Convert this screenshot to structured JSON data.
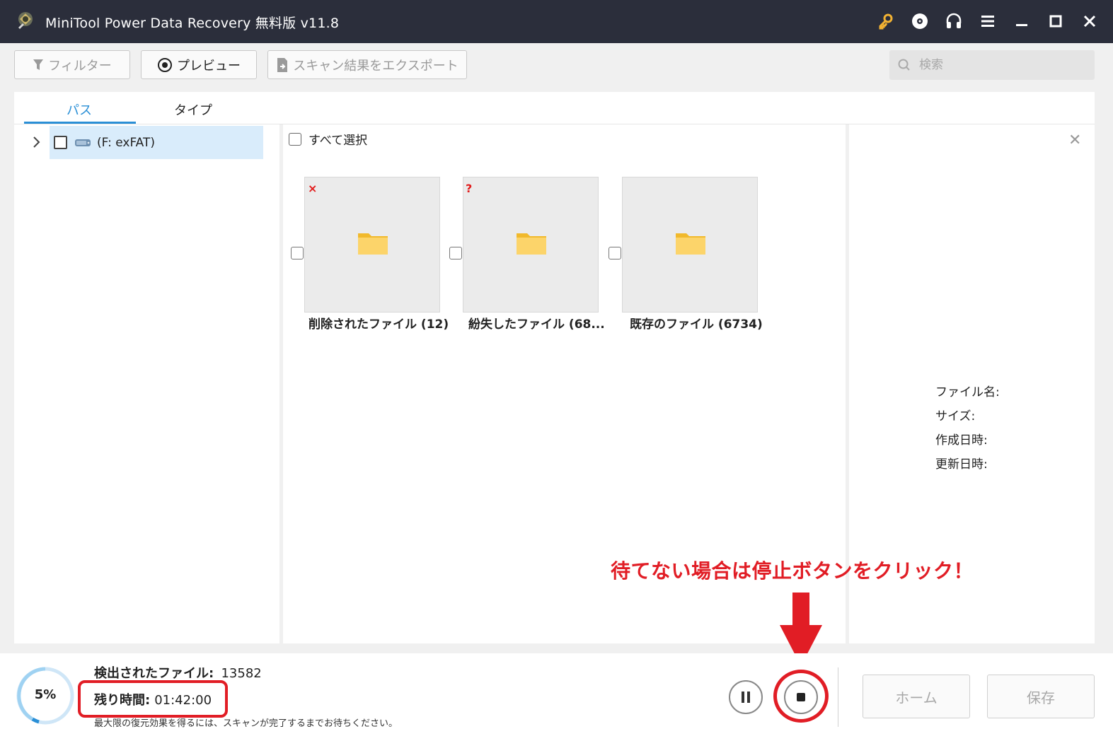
{
  "window": {
    "title": "MiniTool Power Data Recovery 無料版 v11.8",
    "icons": [
      "key-icon",
      "disc-icon",
      "headset-icon",
      "menu-icon",
      "minimize-icon",
      "maximize-icon",
      "close-icon"
    ]
  },
  "toolbar": {
    "filter_label": "フィルター",
    "preview_label": "プレビュー",
    "export_label": "スキャン結果をエクスポート",
    "search_placeholder": "検索"
  },
  "tabs": [
    {
      "label": "パス",
      "active": true
    },
    {
      "label": "タイプ",
      "active": false
    }
  ],
  "tree": {
    "items": [
      {
        "label": "(F: exFAT)",
        "selected": true
      }
    ]
  },
  "content": {
    "select_all_label": "すべて選択",
    "folders": [
      {
        "label": "削除されたファイル (12)",
        "badge": "×"
      },
      {
        "label": "紛失したファイル (68...",
        "badge": "?"
      },
      {
        "label": "既存のファイル (6734)",
        "badge": ""
      }
    ]
  },
  "details": {
    "filename_label": "ファイル名:",
    "size_label": "サイズ:",
    "created_label": "作成日時:",
    "modified_label": "更新日時:"
  },
  "annotation": {
    "text": "待てない場合は停止ボタンをクリック！",
    "color": "#e11d25"
  },
  "status": {
    "progress_percent": 5,
    "progress_label": "5%",
    "found_label": "検出されたファイル:",
    "found_value": "13582",
    "remaining_label": "残り時間:",
    "remaining_value": "01:42:00",
    "hint": "最大限の復元効果を得るには、スキャンが完了するまでお待ちください。"
  },
  "buttons": {
    "home_label": "ホーム",
    "save_label": "保存"
  },
  "colors": {
    "titlebar": "#2b2e3b",
    "accent": "#2a8fd6",
    "tree_selected": "#d9ecfb",
    "folder": "#f6c945"
  }
}
